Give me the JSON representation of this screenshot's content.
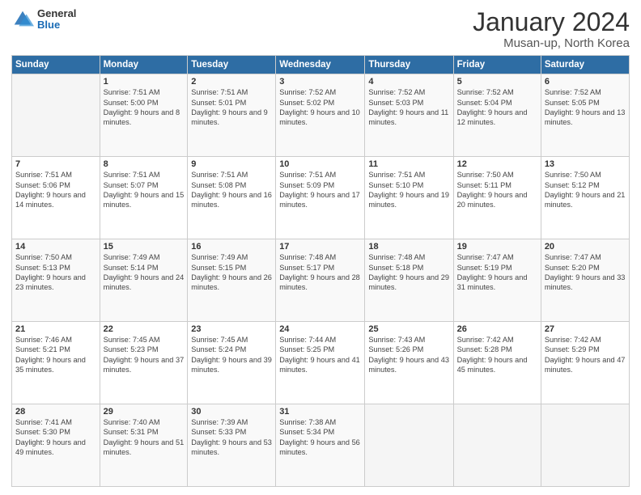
{
  "header": {
    "logo": {
      "general": "General",
      "blue": "Blue"
    },
    "title": "January 2024",
    "subtitle": "Musan-up, North Korea"
  },
  "weekdays": [
    "Sunday",
    "Monday",
    "Tuesday",
    "Wednesday",
    "Thursday",
    "Friday",
    "Saturday"
  ],
  "weeks": [
    [
      {
        "day": "",
        "sunrise": "",
        "sunset": "",
        "daylight": ""
      },
      {
        "day": "1",
        "sunrise": "Sunrise: 7:51 AM",
        "sunset": "Sunset: 5:00 PM",
        "daylight": "Daylight: 9 hours and 8 minutes."
      },
      {
        "day": "2",
        "sunrise": "Sunrise: 7:51 AM",
        "sunset": "Sunset: 5:01 PM",
        "daylight": "Daylight: 9 hours and 9 minutes."
      },
      {
        "day": "3",
        "sunrise": "Sunrise: 7:52 AM",
        "sunset": "Sunset: 5:02 PM",
        "daylight": "Daylight: 9 hours and 10 minutes."
      },
      {
        "day": "4",
        "sunrise": "Sunrise: 7:52 AM",
        "sunset": "Sunset: 5:03 PM",
        "daylight": "Daylight: 9 hours and 11 minutes."
      },
      {
        "day": "5",
        "sunrise": "Sunrise: 7:52 AM",
        "sunset": "Sunset: 5:04 PM",
        "daylight": "Daylight: 9 hours and 12 minutes."
      },
      {
        "day": "6",
        "sunrise": "Sunrise: 7:52 AM",
        "sunset": "Sunset: 5:05 PM",
        "daylight": "Daylight: 9 hours and 13 minutes."
      }
    ],
    [
      {
        "day": "7",
        "sunrise": "Sunrise: 7:51 AM",
        "sunset": "Sunset: 5:06 PM",
        "daylight": "Daylight: 9 hours and 14 minutes."
      },
      {
        "day": "8",
        "sunrise": "Sunrise: 7:51 AM",
        "sunset": "Sunset: 5:07 PM",
        "daylight": "Daylight: 9 hours and 15 minutes."
      },
      {
        "day": "9",
        "sunrise": "Sunrise: 7:51 AM",
        "sunset": "Sunset: 5:08 PM",
        "daylight": "Daylight: 9 hours and 16 minutes."
      },
      {
        "day": "10",
        "sunrise": "Sunrise: 7:51 AM",
        "sunset": "Sunset: 5:09 PM",
        "daylight": "Daylight: 9 hours and 17 minutes."
      },
      {
        "day": "11",
        "sunrise": "Sunrise: 7:51 AM",
        "sunset": "Sunset: 5:10 PM",
        "daylight": "Daylight: 9 hours and 19 minutes."
      },
      {
        "day": "12",
        "sunrise": "Sunrise: 7:50 AM",
        "sunset": "Sunset: 5:11 PM",
        "daylight": "Daylight: 9 hours and 20 minutes."
      },
      {
        "day": "13",
        "sunrise": "Sunrise: 7:50 AM",
        "sunset": "Sunset: 5:12 PM",
        "daylight": "Daylight: 9 hours and 21 minutes."
      }
    ],
    [
      {
        "day": "14",
        "sunrise": "Sunrise: 7:50 AM",
        "sunset": "Sunset: 5:13 PM",
        "daylight": "Daylight: 9 hours and 23 minutes."
      },
      {
        "day": "15",
        "sunrise": "Sunrise: 7:49 AM",
        "sunset": "Sunset: 5:14 PM",
        "daylight": "Daylight: 9 hours and 24 minutes."
      },
      {
        "day": "16",
        "sunrise": "Sunrise: 7:49 AM",
        "sunset": "Sunset: 5:15 PM",
        "daylight": "Daylight: 9 hours and 26 minutes."
      },
      {
        "day": "17",
        "sunrise": "Sunrise: 7:48 AM",
        "sunset": "Sunset: 5:17 PM",
        "daylight": "Daylight: 9 hours and 28 minutes."
      },
      {
        "day": "18",
        "sunrise": "Sunrise: 7:48 AM",
        "sunset": "Sunset: 5:18 PM",
        "daylight": "Daylight: 9 hours and 29 minutes."
      },
      {
        "day": "19",
        "sunrise": "Sunrise: 7:47 AM",
        "sunset": "Sunset: 5:19 PM",
        "daylight": "Daylight: 9 hours and 31 minutes."
      },
      {
        "day": "20",
        "sunrise": "Sunrise: 7:47 AM",
        "sunset": "Sunset: 5:20 PM",
        "daylight": "Daylight: 9 hours and 33 minutes."
      }
    ],
    [
      {
        "day": "21",
        "sunrise": "Sunrise: 7:46 AM",
        "sunset": "Sunset: 5:21 PM",
        "daylight": "Daylight: 9 hours and 35 minutes."
      },
      {
        "day": "22",
        "sunrise": "Sunrise: 7:45 AM",
        "sunset": "Sunset: 5:23 PM",
        "daylight": "Daylight: 9 hours and 37 minutes."
      },
      {
        "day": "23",
        "sunrise": "Sunrise: 7:45 AM",
        "sunset": "Sunset: 5:24 PM",
        "daylight": "Daylight: 9 hours and 39 minutes."
      },
      {
        "day": "24",
        "sunrise": "Sunrise: 7:44 AM",
        "sunset": "Sunset: 5:25 PM",
        "daylight": "Daylight: 9 hours and 41 minutes."
      },
      {
        "day": "25",
        "sunrise": "Sunrise: 7:43 AM",
        "sunset": "Sunset: 5:26 PM",
        "daylight": "Daylight: 9 hours and 43 minutes."
      },
      {
        "day": "26",
        "sunrise": "Sunrise: 7:42 AM",
        "sunset": "Sunset: 5:28 PM",
        "daylight": "Daylight: 9 hours and 45 minutes."
      },
      {
        "day": "27",
        "sunrise": "Sunrise: 7:42 AM",
        "sunset": "Sunset: 5:29 PM",
        "daylight": "Daylight: 9 hours and 47 minutes."
      }
    ],
    [
      {
        "day": "28",
        "sunrise": "Sunrise: 7:41 AM",
        "sunset": "Sunset: 5:30 PM",
        "daylight": "Daylight: 9 hours and 49 minutes."
      },
      {
        "day": "29",
        "sunrise": "Sunrise: 7:40 AM",
        "sunset": "Sunset: 5:31 PM",
        "daylight": "Daylight: 9 hours and 51 minutes."
      },
      {
        "day": "30",
        "sunrise": "Sunrise: 7:39 AM",
        "sunset": "Sunset: 5:33 PM",
        "daylight": "Daylight: 9 hours and 53 minutes."
      },
      {
        "day": "31",
        "sunrise": "Sunrise: 7:38 AM",
        "sunset": "Sunset: 5:34 PM",
        "daylight": "Daylight: 9 hours and 56 minutes."
      },
      {
        "day": "",
        "sunrise": "",
        "sunset": "",
        "daylight": ""
      },
      {
        "day": "",
        "sunrise": "",
        "sunset": "",
        "daylight": ""
      },
      {
        "day": "",
        "sunrise": "",
        "sunset": "",
        "daylight": ""
      }
    ]
  ]
}
